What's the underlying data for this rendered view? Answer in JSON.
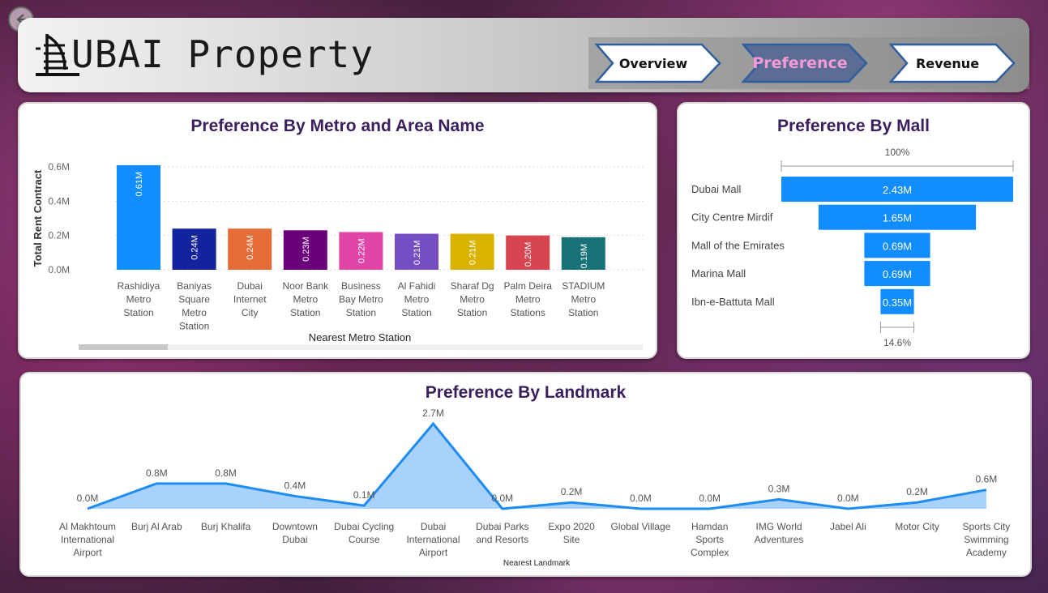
{
  "header": {
    "title": "UBAI Property",
    "nav": [
      {
        "label": "Overview",
        "active": false
      },
      {
        "label": "Preference",
        "active": true
      },
      {
        "label": "Revenue",
        "active": false
      }
    ]
  },
  "colors": {
    "mall_bar": "#118DFF",
    "landmark_fill": "#A8D1FB",
    "landmark_line": "#1E8CF0",
    "title": "#3B1F5C"
  },
  "chart_data": [
    {
      "type": "bar",
      "title": "Preference By Metro and Area Name",
      "xlabel": "Nearest Metro Station",
      "ylabel": "Total Rent Contract",
      "ylim": [
        0,
        0.6
      ],
      "yticks": [
        "0.0M",
        "0.2M",
        "0.4M",
        "0.6M"
      ],
      "categories": [
        "Rashidiya Metro Station",
        "Baniyas Square Metro Station",
        "Dubai Internet City",
        "Noor Bank Metro Station",
        "Business Bay Metro Station",
        "Al Fahidi Metro Station",
        "Sharaf Dg Metro Station",
        "Palm Deira Metro Stations",
        "STADIUM Metro Station"
      ],
      "category_lines": [
        [
          "Rashidiya",
          "Metro",
          "Station"
        ],
        [
          "Baniyas",
          "Square",
          "Metro",
          "Station"
        ],
        [
          "Dubai",
          "Internet",
          "City"
        ],
        [
          "Noor Bank",
          "Metro",
          "Station"
        ],
        [
          "Business",
          "Bay Metro",
          "Station"
        ],
        [
          "Al Fahidi",
          "Metro",
          "Station"
        ],
        [
          "Sharaf Dg",
          "Metro",
          "Station"
        ],
        [
          "Palm Deira",
          "Metro",
          "Stations"
        ],
        [
          "STADIUM",
          "Metro",
          "Station"
        ]
      ],
      "values": [
        0.61,
        0.24,
        0.24,
        0.23,
        0.22,
        0.21,
        0.21,
        0.2,
        0.19
      ],
      "labels": [
        "0.61M",
        "0.24M",
        "0.24M",
        "0.23M",
        "0.22M",
        "0.21M",
        "0.21M",
        "0.20M",
        "0.19M"
      ],
      "colors": [
        "#118DFF",
        "#12239E",
        "#E66C37",
        "#6B007B",
        "#E044A7",
        "#744EC2",
        "#D9B300",
        "#D64550",
        "#197278"
      ],
      "grid": true
    },
    {
      "type": "funnel",
      "title": "Preference By Mall",
      "categories": [
        "Dubai Mall",
        "City Centre Mirdif",
        "Mall of the Emirates",
        "Marina Mall",
        "Ibn-e-Battuta Mall"
      ],
      "values": [
        2.43,
        1.65,
        0.69,
        0.69,
        0.35
      ],
      "labels": [
        "2.43M",
        "1.65M",
        "0.69M",
        "0.69M",
        "0.35M"
      ],
      "top_percent": "100%",
      "bottom_percent": "14.6%"
    },
    {
      "type": "area",
      "title": "Preference By Landmark",
      "xlabel": "Nearest Landmark",
      "categories": [
        "Al Makhtoum International Airport",
        "Burj Al Arab",
        "Burj Khalifa",
        "Downtown Dubai",
        "Dubai Cycling Course",
        "Dubai International Airport",
        "Dubai Parks and Resorts",
        "Expo 2020 Site",
        "Global Village",
        "Hamdan Sports Complex",
        "IMG World Adventures",
        "Jabel Ali",
        "Motor City",
        "Sports City Swimming Academy"
      ],
      "category_lines": [
        [
          "Al Makhtoum",
          "International",
          "Airport"
        ],
        [
          "Burj Al Arab"
        ],
        [
          "Burj Khalifa"
        ],
        [
          "Downtown",
          "Dubai"
        ],
        [
          "Dubai Cycling",
          "Course"
        ],
        [
          "Dubai",
          "International",
          "Airport"
        ],
        [
          "Dubai Parks",
          "and Resorts"
        ],
        [
          "Expo 2020",
          "Site"
        ],
        [
          "Global Village"
        ],
        [
          "Hamdan",
          "Sports",
          "Complex"
        ],
        [
          "IMG World",
          "Adventures"
        ],
        [
          "Jabel Ali"
        ],
        [
          "Motor City"
        ],
        [
          "Sports City",
          "Swimming",
          "Academy"
        ]
      ],
      "values": [
        0.0,
        0.8,
        0.8,
        0.4,
        0.1,
        2.7,
        0.0,
        0.2,
        0.0,
        0.0,
        0.3,
        0.0,
        0.2,
        0.6
      ],
      "labels": [
        "0.0M",
        "0.8M",
        "0.8M",
        "0.4M",
        "0.1M",
        "2.7M",
        "0.0M",
        "0.2M",
        "0.0M",
        "0.0M",
        "0.3M",
        "0.0M",
        "0.2M",
        "0.6M"
      ]
    }
  ]
}
